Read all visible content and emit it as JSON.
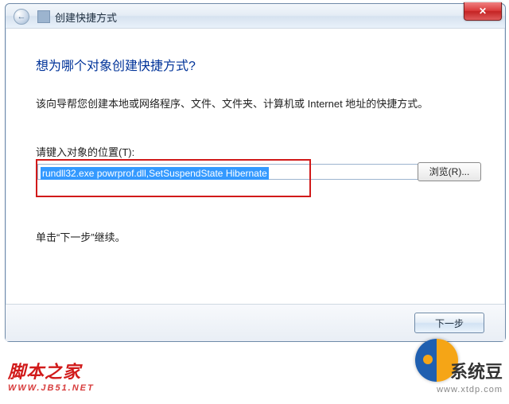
{
  "window": {
    "title": "创建快捷方式",
    "close_glyph": "✕",
    "back_glyph": "←"
  },
  "wizard": {
    "heading": "想为哪个对象创建快捷方式?",
    "description": "该向导帮您创建本地或网络程序、文件、文件夹、计算机或 Internet 地址的快捷方式。",
    "location_label": "请键入对象的位置(T):",
    "location_value": "rundll32.exe powrprof.dll,SetSuspendState Hibernate",
    "browse_label": "浏览(R)...",
    "continue_text": "单击“下一步”继续。",
    "next_label": "下一步"
  },
  "watermarks": {
    "left_main": "脚本之家",
    "left_sub": "WWW.JB51.NET",
    "right_main": "系统豆",
    "right_sub": "www.xtdp.com"
  }
}
